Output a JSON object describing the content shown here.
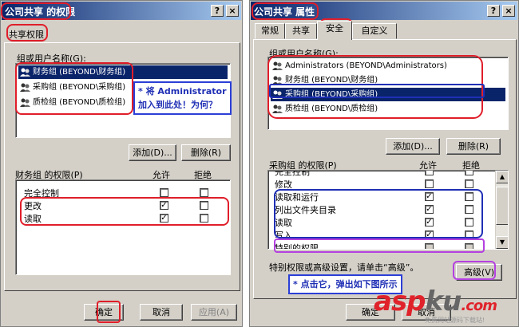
{
  "left": {
    "title": "公司共享 的权限",
    "help_btn": "?",
    "close_btn": "×",
    "tab_label": "共享权限",
    "group_label": "组或用户名称(G):",
    "users": [
      {
        "label": "财务组 (BEYOND\\财务组)"
      },
      {
        "label": "采购组 (BEYOND\\采购组)"
      },
      {
        "label": "质检组 (BEYOND\\质检组)"
      }
    ],
    "note_line1": "* 将 Administrator",
    "note_line2": "加入到此处！为何？",
    "add_btn": "添加(D)...",
    "remove_btn": "删除(R)",
    "perm_title": "财务组 的权限(P)",
    "allow_header": "允许",
    "deny_header": "拒绝",
    "perms": [
      {
        "label": "完全控制",
        "allow": "",
        "deny": ""
      },
      {
        "label": "更改",
        "allow": "✓",
        "deny": ""
      },
      {
        "label": "读取",
        "allow": "✓",
        "deny": ""
      }
    ],
    "ok_btn": "确定",
    "cancel_btn": "取消",
    "apply_btn": "应用(A)"
  },
  "right": {
    "title": "公司共享 属性",
    "help_btn": "?",
    "close_btn": "×",
    "tabs": [
      "常规",
      "共享",
      "安全",
      "自定义"
    ],
    "group_label": "组或用户名称(G):",
    "users": [
      {
        "label": "Administrators (BEYOND\\Administrators)"
      },
      {
        "label": "财务组 (BEYOND\\财务组)"
      },
      {
        "label": "采购组 (BEYOND\\采购组)"
      },
      {
        "label": "质检组 (BEYOND\\质检组)"
      }
    ],
    "add_btn": "添加(D)...",
    "remove_btn": "删除(R)",
    "perm_title": "采购组 的权限(P)",
    "allow_header": "允许",
    "deny_header": "拒绝",
    "perms": [
      {
        "label": "完全控制",
        "allow": "",
        "deny": ""
      },
      {
        "label": "修改",
        "allow": "",
        "deny": ""
      },
      {
        "label": "读取和运行",
        "allow": "✓",
        "deny": ""
      },
      {
        "label": "列出文件夹目录",
        "allow": "✓",
        "deny": ""
      },
      {
        "label": "读取",
        "allow": "✓",
        "deny": ""
      },
      {
        "label": "写入",
        "allow": "✓",
        "deny": ""
      },
      {
        "label": "特别的权限",
        "allow": "",
        "deny": ""
      }
    ],
    "special_hint": "特别权限或高级设置，请单击“高级”。",
    "advanced_btn": "高级(V)",
    "note": "* 点击它，弹出如下图所示",
    "ok_btn": "确定",
    "cancel_btn": "取消"
  },
  "watermark": {
    "brand_a": "asp",
    "brand_b": "ku",
    "brand_c": ".com",
    "sub": "免费网站源码下载站!"
  }
}
